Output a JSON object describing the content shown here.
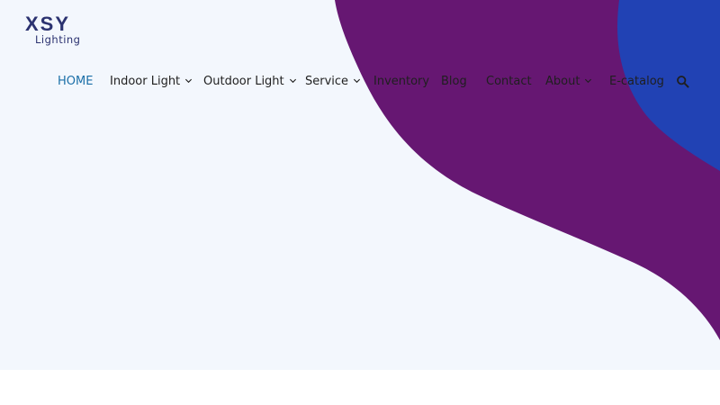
{
  "logo": {
    "main": "XSY",
    "sub": "Lighting"
  },
  "nav": {
    "items": [
      {
        "label": "HOME",
        "has_dropdown": false,
        "active": true
      },
      {
        "label": "Indoor Light",
        "has_dropdown": true,
        "active": false
      },
      {
        "label": "Outdoor Light",
        "has_dropdown": true,
        "active": false
      },
      {
        "label": "Service",
        "has_dropdown": true,
        "active": false
      },
      {
        "label": "Inventory",
        "has_dropdown": false,
        "active": false
      },
      {
        "label": "Blog",
        "has_dropdown": false,
        "active": false
      },
      {
        "label": "Contact",
        "has_dropdown": false,
        "active": false
      },
      {
        "label": "About",
        "has_dropdown": true,
        "active": false
      },
      {
        "label": "E-catalog",
        "has_dropdown": false,
        "active": false
      }
    ],
    "search_icon": "search-icon"
  },
  "colors": {
    "hero_background": "#f3f7fd",
    "wave_purple": "#661772",
    "wave_blue": "#2142b4",
    "logo": "#2b3270",
    "nav_active": "#1b6fa8",
    "nav_text": "#1f1f1f"
  }
}
